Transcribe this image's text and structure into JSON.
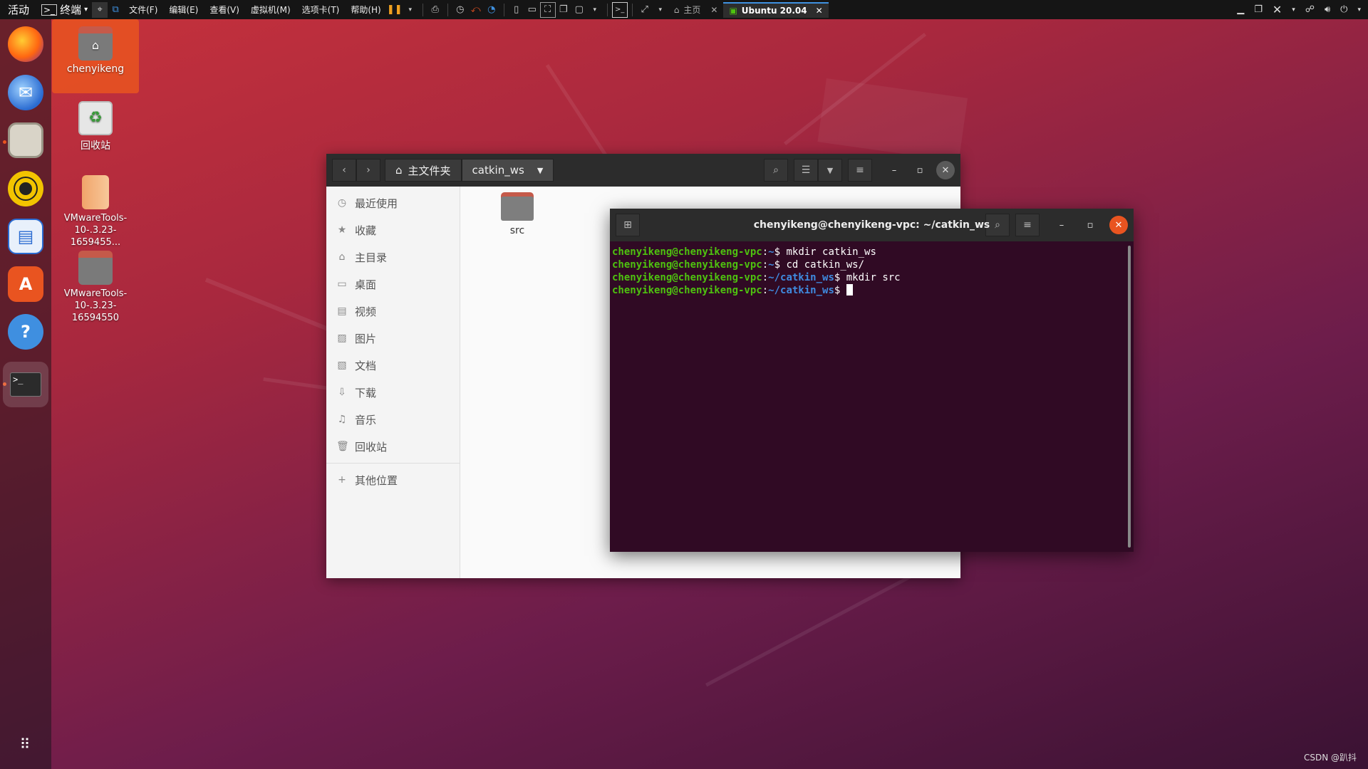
{
  "topbar": {
    "activities": "活动",
    "app_name": "终端",
    "menus": [
      "文件(F)",
      "编辑(E)",
      "查看(V)",
      "虚拟机(M)",
      "选项卡(T)",
      "帮助(H)"
    ],
    "tabs": [
      {
        "label": "主页",
        "active": false
      },
      {
        "label": "Ubuntu 20.04",
        "active": true
      }
    ]
  },
  "desktop": {
    "icons": [
      {
        "label": "chenyikeng",
        "icon": "home-folder-icon",
        "selected": true
      },
      {
        "label": "回收站",
        "icon": "trash-icon",
        "selected": false
      },
      {
        "label": "VMwareTools-10-.3.23-1659455...",
        "icon": "archive-icon",
        "selected": false
      },
      {
        "label": "VMwareTools-10-.3.23-16594550",
        "icon": "folder-icon",
        "selected": false
      }
    ]
  },
  "dock": {
    "items": [
      "firefox-icon",
      "thunderbird-icon",
      "files-icon",
      "rhythmbox-icon",
      "libreoffice-writer-icon",
      "software-center-icon",
      "help-icon",
      "terminal-icon"
    ],
    "show_apps": "show-applications-icon"
  },
  "files_window": {
    "breadcrumb_home": "主文件夹",
    "breadcrumb_current": "catkin_ws",
    "sidebar": [
      {
        "label": "最近使用",
        "icon": "clock-icon"
      },
      {
        "label": "收藏",
        "icon": "star-icon"
      },
      {
        "label": "主目录",
        "icon": "home-icon"
      },
      {
        "label": "桌面",
        "icon": "desktop-icon"
      },
      {
        "label": "视频",
        "icon": "video-icon"
      },
      {
        "label": "图片",
        "icon": "picture-icon"
      },
      {
        "label": "文档",
        "icon": "document-icon"
      },
      {
        "label": "下载",
        "icon": "download-icon"
      },
      {
        "label": "音乐",
        "icon": "music-icon"
      },
      {
        "label": "回收站",
        "icon": "trash-icon"
      }
    ],
    "other_locations": "其他位置",
    "items": [
      {
        "name": "src",
        "icon": "folder-icon"
      }
    ]
  },
  "terminal": {
    "title": "chenyikeng@chenyikeng-vpc: ~/catkin_ws",
    "lines": [
      {
        "user": "chenyikeng@chenyikeng-vpc",
        "path": "~",
        "cmd": " mkdir catkin_ws"
      },
      {
        "user": "chenyikeng@chenyikeng-vpc",
        "path": "~",
        "cmd": " cd catkin_ws/"
      },
      {
        "user": "chenyikeng@chenyikeng-vpc",
        "path": "~/catkin_ws",
        "cmd": " mkdir src"
      },
      {
        "user": "chenyikeng@chenyikeng-vpc",
        "path": "~/catkin_ws",
        "cmd": " "
      }
    ]
  },
  "watermark": "CSDN @趴抖"
}
